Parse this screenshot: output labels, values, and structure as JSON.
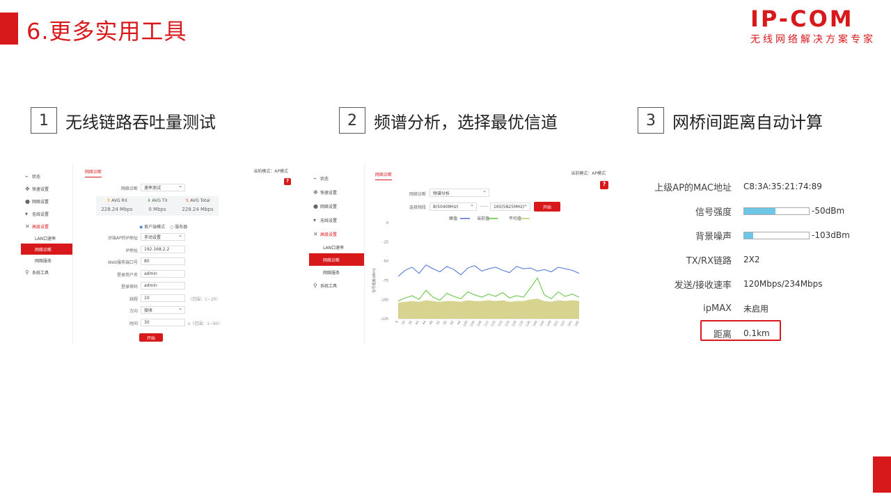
{
  "header": {
    "title": "6.更多实用工具",
    "logo_main": "IP-COM",
    "logo_sub": "无线网络解决方案专家"
  },
  "features": [
    {
      "num": "1",
      "title": "无线链路吞吐量测试"
    },
    {
      "num": "2",
      "title": "频谱分析，选择最优信道"
    },
    {
      "num": "3",
      "title": "网桥间距离自动计算"
    }
  ],
  "sidebar": {
    "items": [
      "状态",
      "快速设置",
      "网络设置",
      "无线设置",
      "高级设置",
      "系统工具"
    ],
    "sub_items": [
      "LAN口速率",
      "网络诊断",
      "网络服务"
    ]
  },
  "panel1": {
    "tab": "网络诊断",
    "mode": "当前模式：AP模式",
    "help": "?",
    "diag_label": "网络诊断",
    "diag_value": "速率测试",
    "stats": [
      {
        "label": "AVG RX",
        "value": "228.24 Mbps",
        "color": "#f5b800"
      },
      {
        "label": "AVG TX",
        "value": "0 Mbps",
        "color": "#4caf50"
      },
      {
        "label": "AVG Total",
        "value": "228.24 Mbps",
        "color": "#ff7043"
      }
    ],
    "radio1": "客户端模式",
    "radio2": "服务器",
    "fields": [
      {
        "label": "对端AP的IP地址",
        "value": "手动设置",
        "select": true,
        "hint": ""
      },
      {
        "label": "IP地址",
        "value": "192.168.2.2",
        "select": false,
        "hint": ""
      },
      {
        "label": "Web服务端口号",
        "value": "80",
        "select": false,
        "hint": ""
      },
      {
        "label": "登录用户名",
        "value": "admin",
        "select": false,
        "hint": ""
      },
      {
        "label": "登录密码",
        "value": "admin",
        "select": false,
        "hint": ""
      },
      {
        "label": "线程",
        "value": "10",
        "select": false,
        "hint": "（范围：1~20）"
      },
      {
        "label": "方向",
        "value": "接收",
        "select": true,
        "hint": ""
      },
      {
        "label": "时间",
        "value": "30",
        "select": false,
        "hint": "s（范围：1~60）"
      }
    ],
    "button": "开始"
  },
  "panel2": {
    "tab": "网络诊断",
    "mode": "当前模式：AP模式",
    "help": "?",
    "diag_label": "网络诊断",
    "diag_value": "频谱分析",
    "freq_label": "选择频段",
    "freq_from": "8(5040MHz)",
    "freq_sep": "——",
    "freq_to": "165(5825MHz)",
    "button": "开始",
    "legend": [
      "峰值",
      "当前值",
      "平均值"
    ],
    "ylabel": "信号强度(dBm)"
  },
  "chart_data": {
    "type": "line",
    "ylabel": "信号强度(dBm)",
    "ylim": [
      -125,
      0
    ],
    "yticks": [
      0,
      -25,
      -50,
      -75,
      -100,
      -125
    ],
    "xticks": [
      "8",
      "16",
      "36",
      "40",
      "44",
      "48",
      "52",
      "56",
      "60",
      "64",
      "100",
      "104",
      "108",
      "112",
      "116",
      "120",
      "124",
      "128",
      "132",
      "136",
      "140",
      "144",
      "149",
      "153",
      "157",
      "161",
      "165"
    ],
    "series": [
      {
        "name": "峰值",
        "color": "#4a6fd8",
        "values": [
          -70,
          -62,
          -58,
          -66,
          -55,
          -60,
          -64,
          -57,
          -61,
          -68,
          -59,
          -56,
          -63,
          -60,
          -58,
          -62,
          -65,
          -57,
          -60,
          -59,
          -63,
          -61,
          -64,
          -58,
          -60,
          -62,
          -66
        ]
      },
      {
        "name": "当前值",
        "color": "#5bc236",
        "values": [
          -102,
          -98,
          -95,
          -100,
          -88,
          -97,
          -101,
          -92,
          -96,
          -99,
          -90,
          -94,
          -97,
          -93,
          -96,
          -91,
          -98,
          -95,
          -97,
          -85,
          -72,
          -94,
          -99,
          -90,
          -96,
          -93,
          -97
        ]
      },
      {
        "name": "平均值",
        "color": "#c9c66a",
        "values": [
          -104,
          -103,
          -102,
          -103,
          -101,
          -102,
          -103,
          -102,
          -102,
          -103,
          -101,
          -102,
          -102,
          -101,
          -102,
          -101,
          -103,
          -102,
          -102,
          -100,
          -99,
          -102,
          -103,
          -101,
          -102,
          -101,
          -102
        ]
      }
    ]
  },
  "panel3": {
    "rows": [
      {
        "key": "上级AP的MAC地址",
        "value": "C8:3A:35:21:74:89"
      },
      {
        "key": "信号强度",
        "value": "-50dBm",
        "level": 0.48
      },
      {
        "key": "背景噪声",
        "value": "-103dBm",
        "level": 0.14
      },
      {
        "key": "TX/RX链路",
        "value": "2X2"
      },
      {
        "key": "发送/接收速率",
        "value": "120Mbps/234Mbps"
      },
      {
        "key": "ipMAX",
        "value": "未启用"
      },
      {
        "key": "距离",
        "value": "0.1km"
      }
    ]
  },
  "colors": {
    "accent": "#d7191c",
    "bar": "#6ec6e6"
  }
}
